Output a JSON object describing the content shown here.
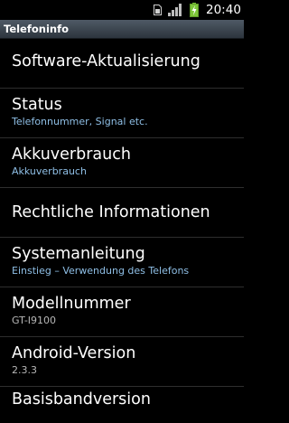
{
  "status_bar": {
    "time": "20:40",
    "icons": [
      "sim-card-icon",
      "signal-strength-icon",
      "battery-charging-icon"
    ],
    "battery_color": "#7ec63a"
  },
  "title_bar": {
    "title": "Telefoninfo"
  },
  "items": [
    {
      "title": "Software-Aktualisierung",
      "subtitle": ""
    },
    {
      "title": "Status",
      "subtitle": "Telefonnummer, Signal etc."
    },
    {
      "title": "Akkuverbrauch",
      "subtitle": "Akkuverbrauch"
    },
    {
      "title": "Rechtliche Informationen",
      "subtitle": ""
    },
    {
      "title": "Systemanleitung",
      "subtitle": "Einstieg – Verwendung des Telefons"
    },
    {
      "title": "Modellnummer",
      "subtitle": "GT-I9100"
    },
    {
      "title": "Android-Version",
      "subtitle": "2.3.3"
    },
    {
      "title": "Basisbandversion",
      "subtitle": ""
    }
  ]
}
